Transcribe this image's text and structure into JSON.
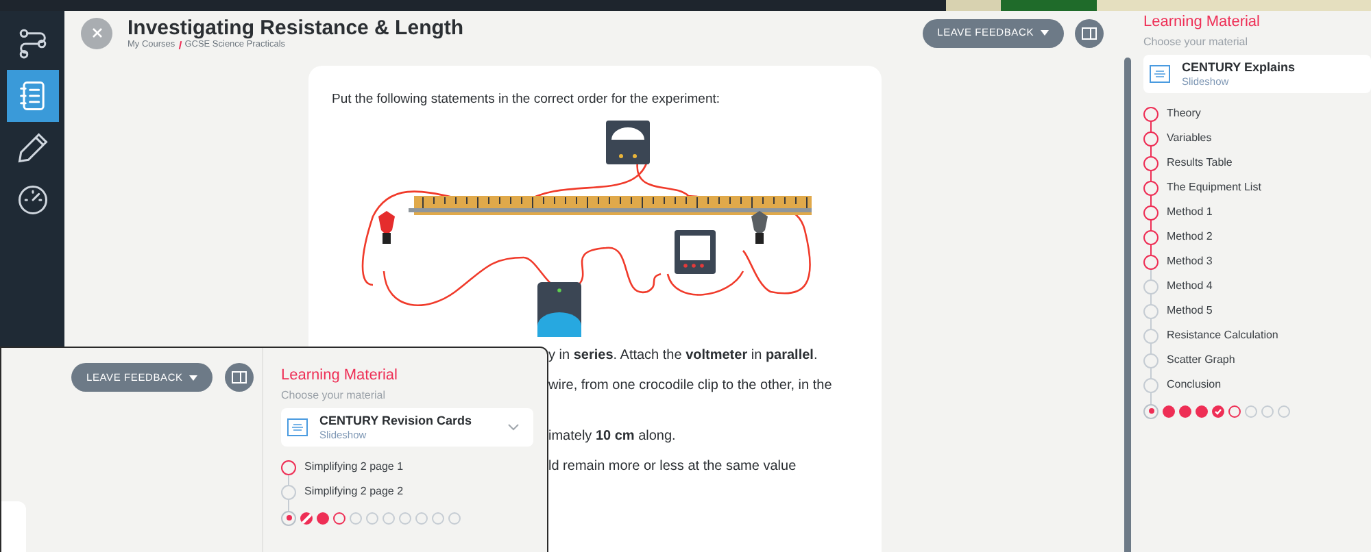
{
  "sidebar": {
    "items": [
      {
        "kind": "flow",
        "selected": false
      },
      {
        "kind": "notebook",
        "selected": true
      },
      {
        "kind": "pencil",
        "selected": false
      },
      {
        "kind": "gauge",
        "selected": false
      }
    ]
  },
  "header": {
    "title": "Investigating Resistance & Length",
    "breadcrumb": [
      "My Courses",
      "GCSE Science Practicals"
    ],
    "feedback_button": "LEAVE FEEDBACK"
  },
  "question": {
    "prompt": "Put the following statements in the correct order for the experiment:",
    "lines": [
      "y in **series**. Attach the **voltmeter** in **parallel**.",
      "wire, from one crocodile clip to the other, in the",
      "imately **10 cm** along.",
      "ld remain more or less at the same value"
    ]
  },
  "learning_panel": {
    "title": "Learning Material",
    "subtitle": "Choose your material",
    "material": {
      "name": "CENTURY Explains",
      "type": "Slideshow"
    },
    "steps": [
      {
        "label": "Theory",
        "completed": true
      },
      {
        "label": "Variables",
        "completed": true
      },
      {
        "label": "Results Table",
        "completed": true
      },
      {
        "label": "The Equipment List",
        "completed": true
      },
      {
        "label": "Method 1",
        "completed": true
      },
      {
        "label": "Method 2",
        "completed": true
      },
      {
        "label": "Method 3",
        "completed": true
      },
      {
        "label": "Method 4",
        "completed": false
      },
      {
        "label": "Method 5",
        "completed": false
      },
      {
        "label": "Resistance Calculation",
        "completed": false
      },
      {
        "label": "Scatter Graph",
        "completed": false
      },
      {
        "label": "Conclusion",
        "completed": false
      }
    ],
    "dots": [
      {
        "kind": "current"
      },
      {
        "kind": "filled"
      },
      {
        "kind": "filled"
      },
      {
        "kind": "filled"
      },
      {
        "kind": "checked"
      },
      {
        "kind": "open"
      },
      {
        "kind": "empty"
      },
      {
        "kind": "empty"
      },
      {
        "kind": "empty"
      }
    ]
  },
  "inset_window": {
    "feedback_button": "LEAVE FEEDBACK",
    "learning_panel": {
      "title": "Learning Material",
      "subtitle": "Choose your material",
      "material": {
        "name": "CENTURY Revision Cards",
        "type": "Slideshow"
      },
      "steps": [
        {
          "label": "Simplifying 2 page 1",
          "completed": true
        },
        {
          "label": "Simplifying 2 page 2",
          "completed": false
        }
      ],
      "dots": [
        {
          "kind": "current"
        },
        {
          "kind": "partial"
        },
        {
          "kind": "filled"
        },
        {
          "kind": "open"
        },
        {
          "kind": "empty"
        },
        {
          "kind": "empty"
        },
        {
          "kind": "empty"
        },
        {
          "kind": "empty"
        },
        {
          "kind": "empty"
        },
        {
          "kind": "empty"
        },
        {
          "kind": "empty"
        }
      ]
    }
  }
}
